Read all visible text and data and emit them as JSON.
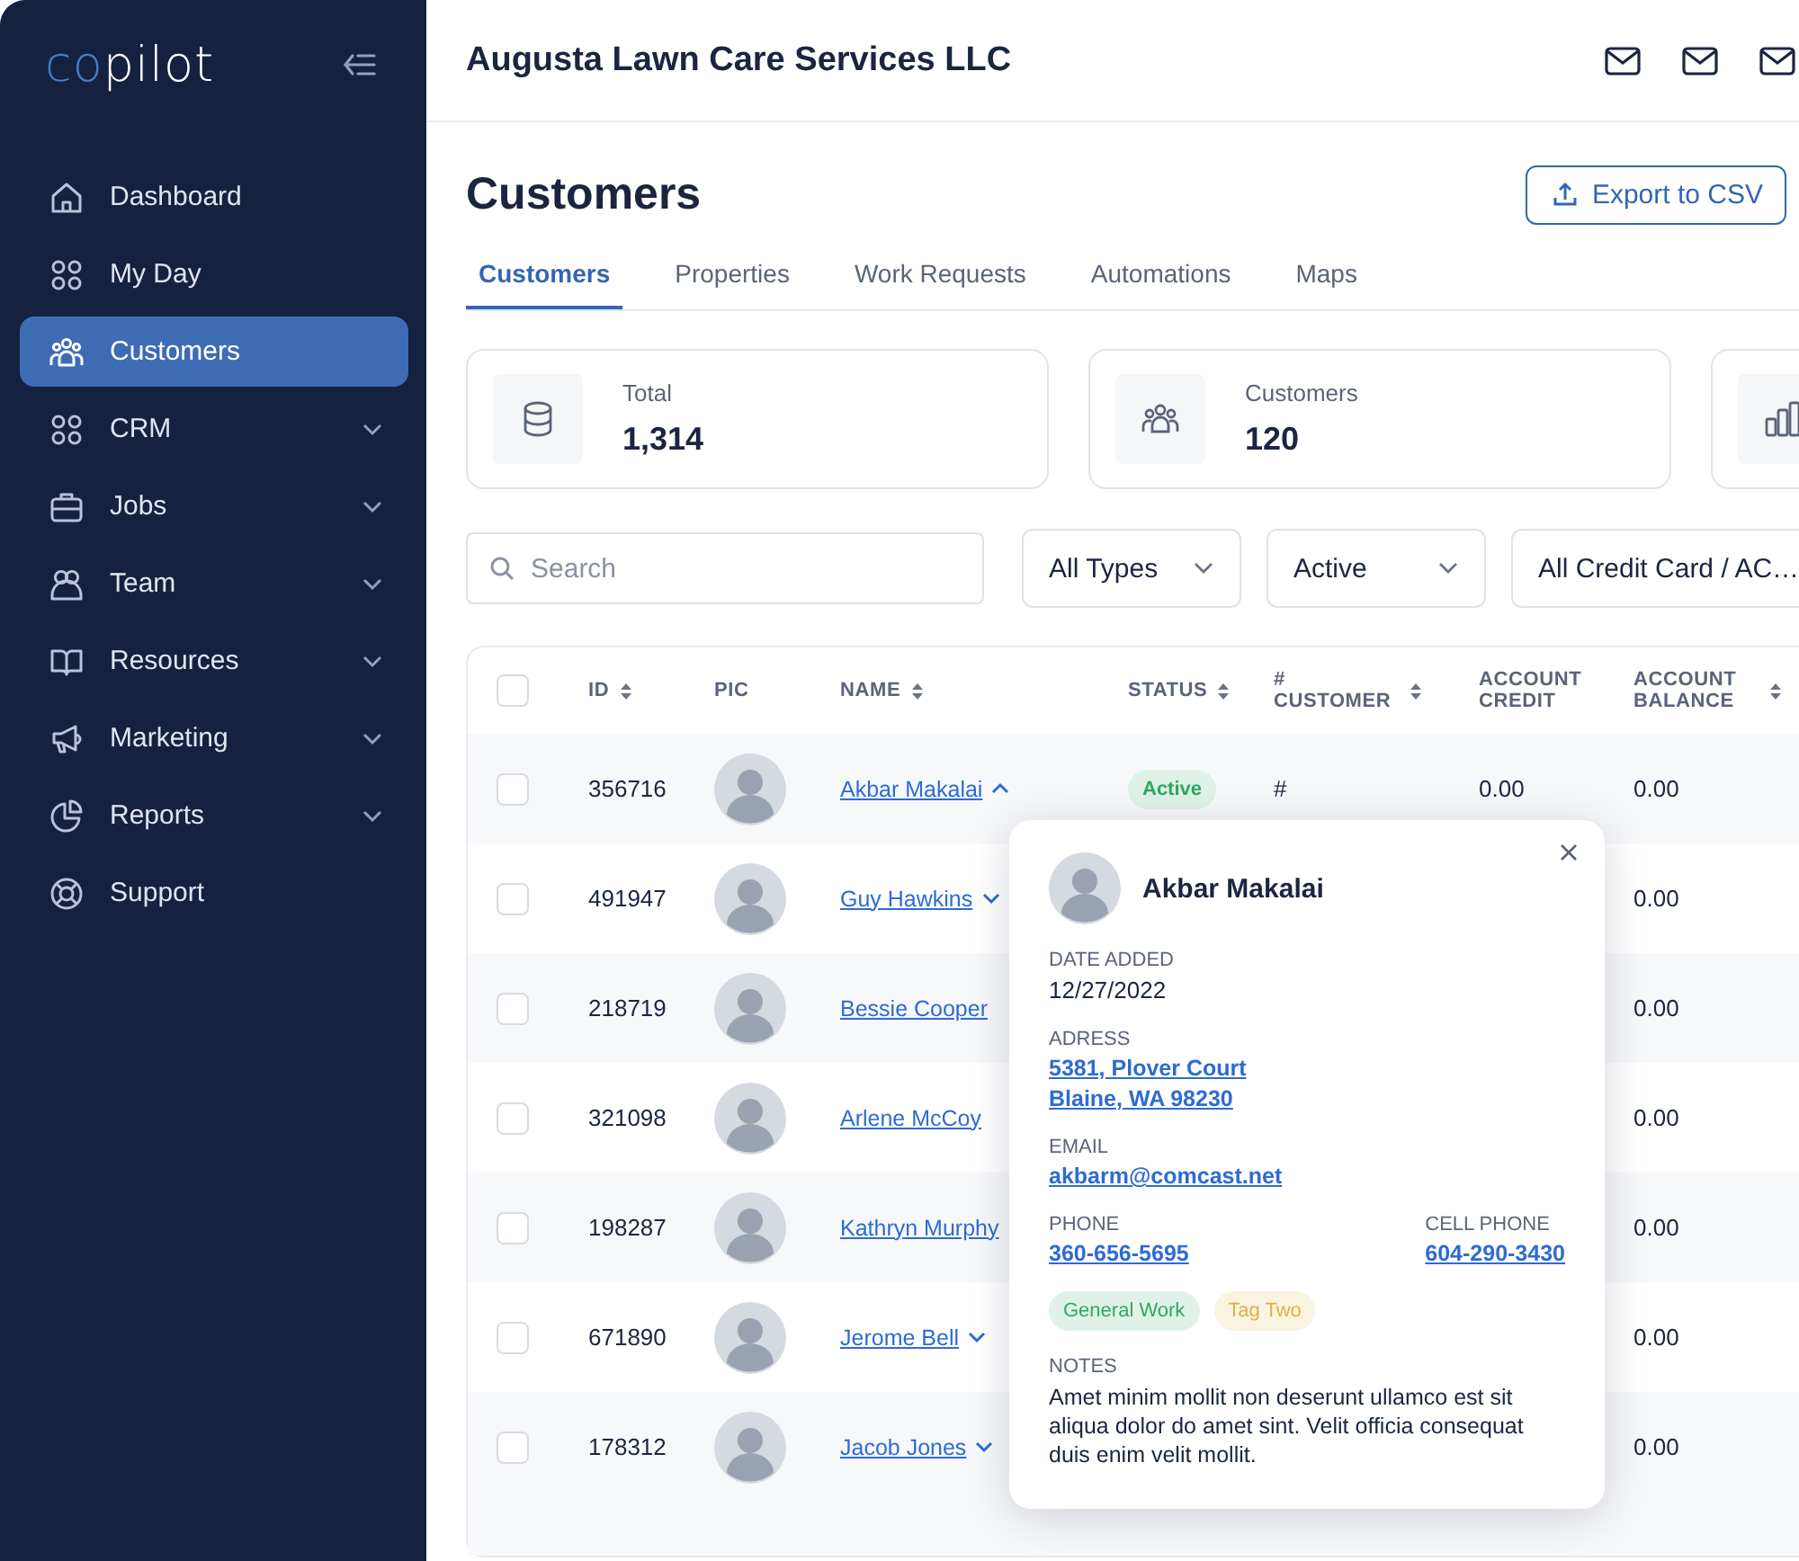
{
  "logo": {
    "accent": "co",
    "rest": "pilot"
  },
  "sidebar": {
    "items": [
      {
        "label": "Dashboard",
        "kind": "link",
        "selected": false
      },
      {
        "label": "My Day",
        "kind": "link",
        "selected": false
      },
      {
        "label": "Customers",
        "kind": "link",
        "selected": true
      },
      {
        "label": "CRM",
        "kind": "group",
        "selected": false
      },
      {
        "label": "Jobs",
        "kind": "group",
        "selected": false
      },
      {
        "label": "Team",
        "kind": "group",
        "selected": false
      },
      {
        "label": "Resources",
        "kind": "group",
        "selected": false
      },
      {
        "label": "Marketing",
        "kind": "group",
        "selected": false
      },
      {
        "label": "Reports",
        "kind": "group",
        "selected": false
      },
      {
        "label": "Support",
        "kind": "link",
        "selected": false
      }
    ]
  },
  "header": {
    "company": "Augusta Lawn Care Services LLC"
  },
  "page": {
    "title": "Customers",
    "export_button": "Export to CSV"
  },
  "tabs": [
    {
      "label": "Customers",
      "selected": true
    },
    {
      "label": "Properties",
      "selected": false
    },
    {
      "label": "Work Requests",
      "selected": false
    },
    {
      "label": "Automations",
      "selected": false
    },
    {
      "label": "Maps",
      "selected": false
    }
  ],
  "stats": [
    {
      "label": "Total",
      "value": "1,314"
    },
    {
      "label": "Customers",
      "value": "120"
    }
  ],
  "filters": {
    "search": {
      "placeholder": "Search"
    },
    "dropdowns": [
      "All Types",
      "Active",
      "All Credit Card / AC…"
    ]
  },
  "table": {
    "select_all_checked": false,
    "columns": [
      {
        "label": "ID",
        "sortable": true
      },
      {
        "label": "PIC",
        "sortable": false
      },
      {
        "label": "NAME",
        "sortable": true
      },
      {
        "label": "STATUS",
        "sortable": true
      },
      {
        "label": "# CUSTOMER",
        "sortable": true
      },
      {
        "label": "ACCOUNT CREDIT",
        "sortable": false
      },
      {
        "label": "ACCOUNT BALANCE",
        "sortable": true
      }
    ],
    "rows": [
      {
        "id": "356716",
        "name": "Akbar Makalai",
        "expanded": true,
        "status": {
          "label": "Active",
          "color": "#2fa85e"
        },
        "customer": "#",
        "credit": "0.00",
        "balance": "0.00",
        "checked": false
      },
      {
        "id": "491947",
        "name": "Guy Hawkins",
        "expanded": false,
        "balance": "0.00",
        "checked": false
      },
      {
        "id": "218719",
        "name": "Bessie Cooper",
        "balance": "0.00",
        "checked": false
      },
      {
        "id": "321098",
        "name": "Arlene McCoy",
        "balance": "0.00",
        "checked": false
      },
      {
        "id": "198287",
        "name": "Kathryn Murphy",
        "balance": "0.00",
        "checked": false
      },
      {
        "id": "671890",
        "name": "Jerome Bell",
        "expanded": false,
        "balance": "0.00",
        "checked": false
      },
      {
        "id": "178312",
        "name": "Jacob Jones",
        "expanded": false,
        "balance": "0.00",
        "checked": false
      }
    ]
  },
  "customer_popover": {
    "name": "Akbar Makalai",
    "date_added": {
      "label": "DATE ADDED",
      "value": "12/27/2022"
    },
    "address": {
      "label": "ADRESS",
      "lines": [
        "5381, Plover Court",
        "Blaine, WA 98230"
      ]
    },
    "email": {
      "label": "EMAIL",
      "value": "akbarm@comcast.net"
    },
    "phone": {
      "label": "PHONE",
      "value": "360-656-5695"
    },
    "cell_phone": {
      "label": "CELL PHONE",
      "value": "604-290-3430"
    },
    "tags": [
      {
        "label": "General Work",
        "color": "#2fa85e"
      },
      {
        "label": "Tag Two",
        "color": "#e0b040"
      }
    ],
    "notes": {
      "label": "NOTES",
      "text": "Amet minim mollit non deserunt ullamco est sit aliqua dolor do amet sint. Velit officia consequat duis enim velit mollit."
    }
  }
}
